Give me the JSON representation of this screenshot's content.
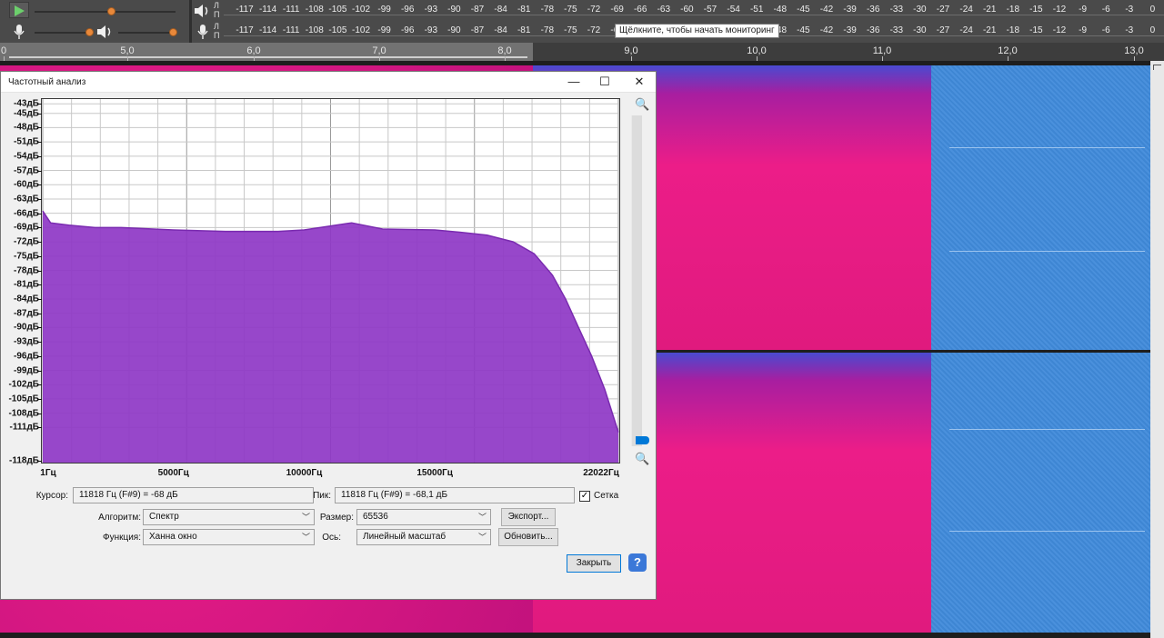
{
  "meter": {
    "channels": [
      "Л",
      "П"
    ],
    "ticks": [
      "-117",
      "-114",
      "-111",
      "-108",
      "-105",
      "-102",
      "-99",
      "-96",
      "-93",
      "-90",
      "-87",
      "-84",
      "-81",
      "-78",
      "-75",
      "-72",
      "-69",
      "-66",
      "-63",
      "-60",
      "-57",
      "-54",
      "-51",
      "-48",
      "-45",
      "-42",
      "-39",
      "-36",
      "-33",
      "-30",
      "-27",
      "-24",
      "-21",
      "-18",
      "-15",
      "-12",
      "-9",
      "-6",
      "-3",
      "0"
    ],
    "tooltip": "Щёлкните, чтобы начать мониторинг",
    "playback_volume": 0.55,
    "record_volume": 0.5
  },
  "ruler": {
    "labels": [
      "0",
      "5,0",
      "6,0",
      "7,0",
      "8,0",
      "9,0",
      "10,0",
      "11,0",
      "12,0",
      "13,0"
    ]
  },
  "dialog": {
    "title": "Частотный анализ",
    "y_labels": [
      "-43дБ",
      "-45дБ",
      "-48дБ",
      "-51дБ",
      "-54дБ",
      "-57дБ",
      "-60дБ",
      "-63дБ",
      "-66дБ",
      "-69дБ",
      "-72дБ",
      "-75дБ",
      "-78дБ",
      "-81дБ",
      "-84дБ",
      "-87дБ",
      "-90дБ",
      "-93дБ",
      "-96дБ",
      "-99дБ",
      "-102дБ",
      "-105дБ",
      "-108дБ",
      "-111дБ",
      "-118дБ"
    ],
    "x_labels": [
      "1Гц",
      "5000Гц",
      "10000Гц",
      "15000Гц",
      "22022Гц"
    ],
    "cursor_label": "Курсор:",
    "cursor_value": "11818 Гц (F#9) = -68 дБ",
    "peak_label": "Пик:",
    "peak_value": "11818 Гц (F#9) = -68,1 дБ",
    "grid_label": "Сетка",
    "grid_checked_mark": "✓",
    "algorithm_label": "Алгоритм:",
    "algorithm_value": "Спектр",
    "size_label": "Размер:",
    "size_value": "65536",
    "export_button": "Экспорт...",
    "function_label": "Функция:",
    "function_value": "Ханна окно",
    "axis_label": "Ось:",
    "axis_value": "Линейный масштаб",
    "update_button": "Обновить...",
    "close_button": "Закрыть",
    "help_glyph": "?",
    "zoom_in_glyph": "🔍",
    "zoom_out_glyph": "🔍"
  },
  "chart_data": {
    "type": "area",
    "title": "",
    "xlabel": "",
    "ylabel": "",
    "xlim": [
      1,
      22022
    ],
    "ylim": [
      -118,
      -42
    ],
    "x_unit": "Гц",
    "y_unit": "дБ",
    "grid": true,
    "series": [
      {
        "color": "#8e37c6",
        "x": [
          1,
          300,
          1000,
          2000,
          3000,
          5000,
          7000,
          9000,
          10000,
          11818,
          13000,
          15000,
          16000,
          17000,
          18000,
          18800,
          19500,
          20000,
          20500,
          21000,
          21500,
          22022
        ],
        "y": [
          -65.5,
          -68,
          -68.5,
          -69,
          -69,
          -69.5,
          -69.8,
          -69.8,
          -69.5,
          -68,
          -69.3,
          -69.5,
          -70,
          -70.6,
          -72,
          -74.5,
          -79,
          -84,
          -90,
          -96,
          -103,
          -112
        ]
      }
    ]
  }
}
